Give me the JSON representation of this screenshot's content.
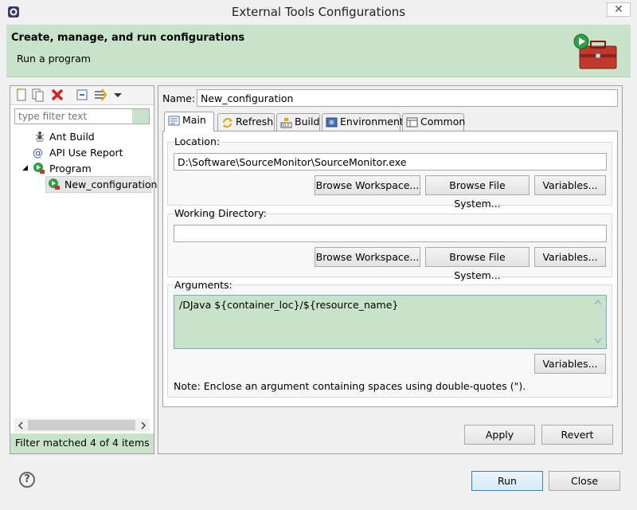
{
  "window": {
    "title": "External Tools Configurations",
    "close_glyph": "✕"
  },
  "banner": {
    "title": "Create, manage, and run configurations",
    "subtitle": "Run a program"
  },
  "left": {
    "filter_placeholder": "type filter text",
    "tree": [
      {
        "label": "Ant Build",
        "icon": "ant-icon"
      },
      {
        "label": "API Use Report",
        "icon": "api-report-icon"
      },
      {
        "label": "Program",
        "icon": "program-icon",
        "expanded": true
      },
      {
        "label": "New_configuration",
        "icon": "program-config-icon",
        "selected": true
      }
    ],
    "expand_glyph": "◢",
    "status": "Filter matched 4 of 4 items"
  },
  "right": {
    "name_label": "Name:",
    "name_value": "New_configuration",
    "tabs": [
      {
        "label": "Main",
        "icon": "main-tab-icon",
        "active": true
      },
      {
        "label": "Refresh",
        "icon": "refresh-icon"
      },
      {
        "label": "Build",
        "icon": "build-icon"
      },
      {
        "label": "Environment",
        "icon": "environment-icon"
      },
      {
        "label": "Common",
        "icon": "common-icon"
      }
    ],
    "location": {
      "label": "Location:",
      "value": "D:\\Software\\SourceMonitor\\SourceMonitor.exe"
    },
    "working_dir": {
      "label": "Working Directory:",
      "value": ""
    },
    "arguments": {
      "label": "Arguments:",
      "value": "/DJava ${container_loc}/${resource_name}"
    },
    "buttons": {
      "browse_workspace": "Browse Workspace...",
      "browse_fs": "Browse File System...",
      "variables": "Variables..."
    },
    "note": "Note: Enclose an argument containing spaces using double-quotes (\").",
    "apply": "Apply",
    "revert": "Revert"
  },
  "footer": {
    "help": "?",
    "run": "Run",
    "close": "Close"
  },
  "colors": {
    "banner_green": "#c9e3ca",
    "default_button_border": "#3c7fb1"
  }
}
